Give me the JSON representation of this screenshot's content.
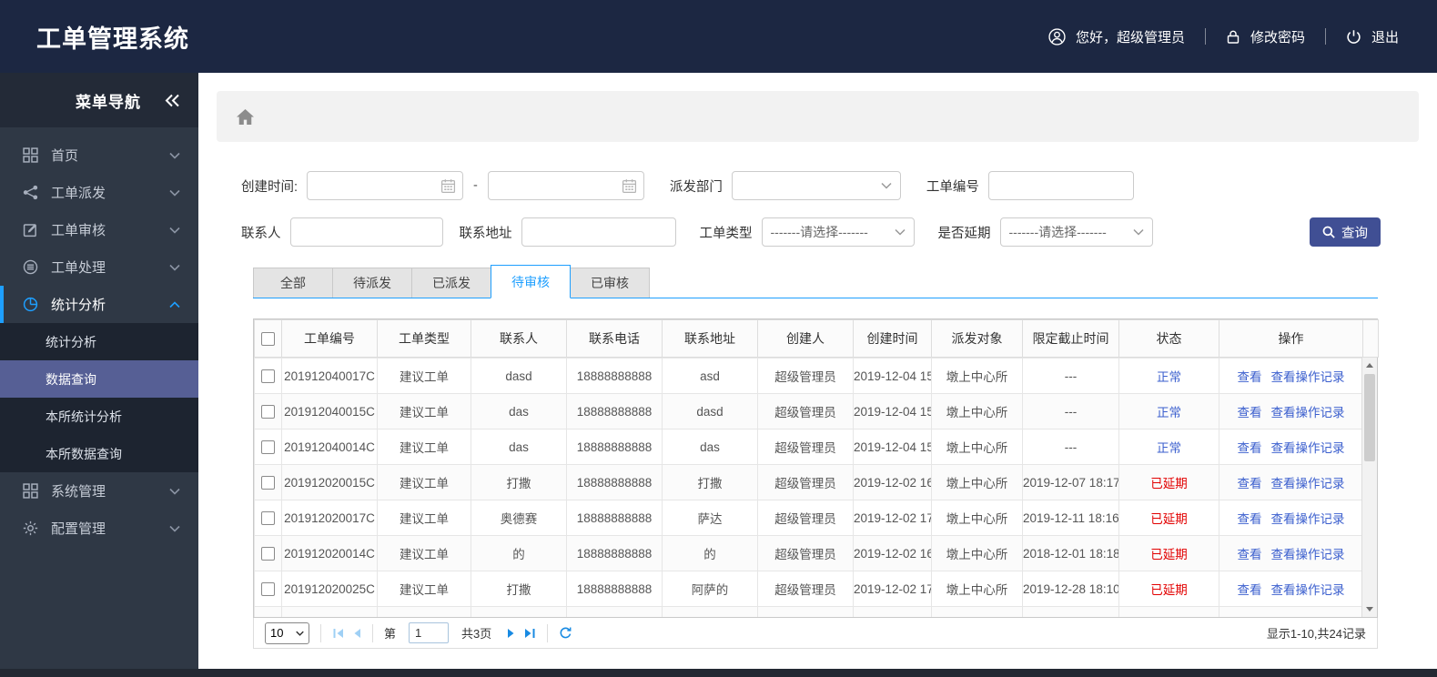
{
  "header": {
    "title": "工单管理系统",
    "user_icon": "person-circle",
    "greeting": "您好，超级管理员",
    "lock_icon": "padlock",
    "change_password": "修改密码",
    "power_icon": "power",
    "logout": "退出"
  },
  "sidebar": {
    "title": "菜单导航",
    "collapse_icon": "double-chevron-left",
    "items": [
      {
        "label": "首页",
        "icon": "grid"
      },
      {
        "label": "工单派发",
        "icon": "share"
      },
      {
        "label": "工单审核",
        "icon": "edit"
      },
      {
        "label": "工单处理",
        "icon": "stack"
      },
      {
        "label": "统计分析",
        "icon": "pie",
        "active": true,
        "children": [
          "统计分析",
          "数据查询",
          "本所统计分析",
          "本所数据查询"
        ],
        "selected_child": "数据查询"
      },
      {
        "label": "系统管理",
        "icon": "grid"
      },
      {
        "label": "配置管理",
        "icon": "gear"
      }
    ]
  },
  "breadcrumb": {
    "home_icon": "home"
  },
  "filters": {
    "create_time_label": "创建时间:",
    "range_separator": "-",
    "dispatch_dept_label": "派发部门",
    "order_no_label": "工单编号",
    "contact_label": "联系人",
    "address_label": "联系地址",
    "order_type_label": "工单类型",
    "delay_label": "是否延期",
    "select_placeholder": "-------请选择-------",
    "search_button": "查询"
  },
  "tabs": {
    "items": [
      "全部",
      "待派发",
      "已派发",
      "待审核",
      "已审核"
    ],
    "active": "待审核"
  },
  "table": {
    "columns": [
      "工单编号",
      "工单类型",
      "联系人",
      "联系电话",
      "联系地址",
      "创建人",
      "创建时间",
      "派发对象",
      "限定截止时间",
      "状态",
      "操作"
    ],
    "action_labels": [
      "查看",
      "查看操作记录"
    ],
    "rows": [
      {
        "order_no": "201912040017C",
        "order_type": "建议工单",
        "contact": "dasd",
        "phone": "18888888888",
        "address": "asd",
        "creator": "超级管理员",
        "create_time": "2019-12-04 15",
        "dispatch_target": "墩上中心所",
        "deadline": "---",
        "status": "正常",
        "status_type": "normal"
      },
      {
        "order_no": "201912040015C",
        "order_type": "建议工单",
        "contact": "das",
        "phone": "18888888888",
        "address": "dasd",
        "creator": "超级管理员",
        "create_time": "2019-12-04 15",
        "dispatch_target": "墩上中心所",
        "deadline": "---",
        "status": "正常",
        "status_type": "normal"
      },
      {
        "order_no": "201912040014C",
        "order_type": "建议工单",
        "contact": "das",
        "phone": "18888888888",
        "address": "das",
        "creator": "超级管理员",
        "create_time": "2019-12-04 15",
        "dispatch_target": "墩上中心所",
        "deadline": "---",
        "status": "正常",
        "status_type": "normal"
      },
      {
        "order_no": "201912020015C",
        "order_type": "建议工单",
        "contact": "打撒",
        "phone": "18888888888",
        "address": "打撒",
        "creator": "超级管理员",
        "create_time": "2019-12-02 16",
        "dispatch_target": "墩上中心所",
        "deadline": "2019-12-07 18:17",
        "status": "已延期",
        "status_type": "delayed"
      },
      {
        "order_no": "201912020017C",
        "order_type": "建议工单",
        "contact": "奥德赛",
        "phone": "18888888888",
        "address": "萨达",
        "creator": "超级管理员",
        "create_time": "2019-12-02 17",
        "dispatch_target": "墩上中心所",
        "deadline": "2019-12-11 18:16",
        "status": "已延期",
        "status_type": "delayed"
      },
      {
        "order_no": "201912020014C",
        "order_type": "建议工单",
        "contact": "的",
        "phone": "18888888888",
        "address": "的",
        "creator": "超级管理员",
        "create_time": "2019-12-02 16",
        "dispatch_target": "墩上中心所",
        "deadline": "2018-12-01 18:18",
        "status": "已延期",
        "status_type": "delayed"
      },
      {
        "order_no": "201912020025C",
        "order_type": "建议工单",
        "contact": "打撒",
        "phone": "18888888888",
        "address": "阿萨的",
        "creator": "超级管理员",
        "create_time": "2019-12-02 17",
        "dispatch_target": "墩上中心所",
        "deadline": "2019-12-28 18:10",
        "status": "已延期",
        "status_type": "delayed"
      }
    ]
  },
  "pagination": {
    "selected_page_size": "10",
    "page_label_prefix": "第",
    "current_page": "1",
    "total_pages_label": "共3页",
    "records_summary": "显示1-10,共24记录"
  },
  "colors": {
    "header_navy": "#1c2742",
    "sidebar_dark": "#2f3845",
    "accent_blue": "#1e9fff",
    "selected_submenu": "#565f95",
    "search_button": "#404f94",
    "link_blue": "#3b5fce",
    "danger_red": "#e20000"
  }
}
